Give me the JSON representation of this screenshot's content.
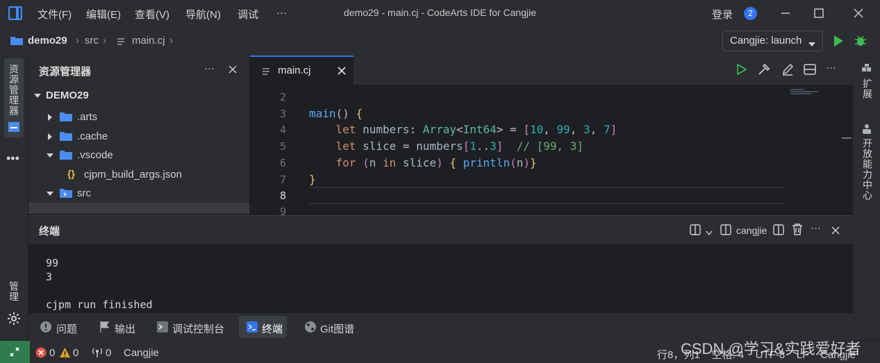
{
  "titlebar": {
    "menus": [
      "文件(F)",
      "编辑(E)",
      "查看(V)",
      "导航(N)",
      "调试",
      "···"
    ],
    "window_title": "demo29 - main.cj - CodeArts IDE for Cangjie",
    "login": "登录",
    "notification_count": "2"
  },
  "breadcrumb": {
    "project": "demo29",
    "folder": "src",
    "file": "main.cj"
  },
  "run": {
    "config_label": "Cangjie: launch"
  },
  "activity_left": {
    "explorer_label": "资源管理器",
    "manage_label": "管理"
  },
  "activity_right": {
    "extensions_label": "扩展",
    "open_ability_label": "开放能力中心"
  },
  "explorer": {
    "title": "资源管理器",
    "root": "DEMO29",
    "items": [
      {
        "label": ".arts"
      },
      {
        "label": ".cache"
      },
      {
        "label": ".vscode"
      },
      {
        "label": "cjpm_build_args.json"
      },
      {
        "label": "src"
      }
    ]
  },
  "editor": {
    "tab_label": "main.cj",
    "line_numbers": [
      "2",
      "3",
      "4",
      "5",
      "6",
      "7",
      "8",
      "9"
    ]
  },
  "terminal": {
    "title": "终端",
    "profile": "cangjie",
    "output": [
      "99",
      "3",
      "",
      "cjpm run finished"
    ]
  },
  "panel_tabs": [
    "问题",
    "输出",
    "调试控制台",
    "终端",
    "Git图谱"
  ],
  "statusbar": {
    "errors": "0",
    "warnings": "0",
    "ports": "0",
    "language": "Cangjie",
    "right": "行8，列1    空格: 4    UTF-8    LF    Cangjie"
  },
  "watermark": "CSDN @学习&实践爱好者",
  "colors": {
    "accent": "#3574f0",
    "remote": "#2f7d4f",
    "run_green": "#3fb950"
  }
}
